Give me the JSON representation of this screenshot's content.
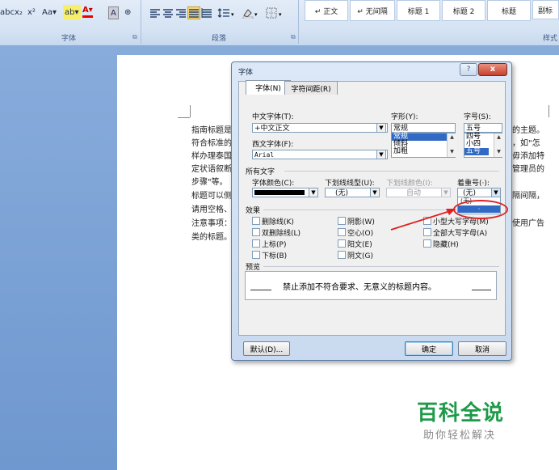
{
  "ribbon": {
    "font_tools": [
      "abc",
      "x₂",
      "x²",
      "Aa▾",
      "ab▾",
      "A▾",
      "A",
      "⊕"
    ],
    "font_group_label": "字体",
    "para_group_label": "段落",
    "styles_group_label": "样式",
    "styles": [
      "↵ 正文",
      "↵ 无间隔",
      "标题 1",
      "标题 2",
      "标题",
      "副标"
    ]
  },
  "doc_lines": [
    "指南标题是",
    "符合标准的",
    "样办理泰国",
    "定状语叙断",
    "步骤\"等。",
    "标题可以侧",
    "请用空格、",
    "注意事项：",
    "类的标题。"
  ],
  "doc_right": [
    "的主题。",
    "，如\"怎",
    "毋添加特",
    "管理员的",
    "",
    "隔间隔，",
    "",
    "使用广告"
  ],
  "brand": {
    "name": "百科全说",
    "slogan": "助你轻松解决"
  },
  "dialog": {
    "title": "字体",
    "help": "?",
    "close": "x",
    "tabs": [
      "字体(N)",
      "字符间距(R)"
    ],
    "cn_font_label": "中文字体(T):",
    "cn_font_value": "+中文正文",
    "west_font_label": "西文字体(F):",
    "west_font_value": "Arial",
    "style_label": "字形(Y):",
    "style_value": "常规",
    "style_options": [
      "常规",
      "倾斜",
      "加粗"
    ],
    "size_label": "字号(S):",
    "size_value": "五号",
    "size_options": [
      "四号",
      "小四",
      "五号"
    ],
    "all_text_label": "所有文字",
    "font_color_label": "字体颜色(C):",
    "underline_label": "下划线线型(U):",
    "underline_value": "(无)",
    "underline_color_label": "下划线颜色(I):",
    "underline_color_value": "自动",
    "emphasis_label": "着重号(·):",
    "emphasis_value": "(无)",
    "emphasis_options": [
      "(无)",
      "·"
    ],
    "effects_label": "效果",
    "effects": [
      [
        "删除线(K)",
        "阴影(W)",
        "小型大写字母(M)"
      ],
      [
        "双删除线(L)",
        "空心(O)",
        "全部大写字母(A)"
      ],
      [
        "上标(P)",
        "阳文(E)",
        "隐藏(H)"
      ],
      [
        "下标(B)",
        "阴文(G)",
        ""
      ]
    ],
    "preview_label": "预览",
    "preview_text": "禁止添加不符合要求、无意义的标题内容。",
    "default_btn": "默认(D)...",
    "ok_btn": "确定",
    "cancel_btn": "取消"
  },
  "colors": {
    "annotation_red": "#e02020",
    "selection_blue": "#316ac5",
    "brand_green": "#1e9a4a"
  }
}
